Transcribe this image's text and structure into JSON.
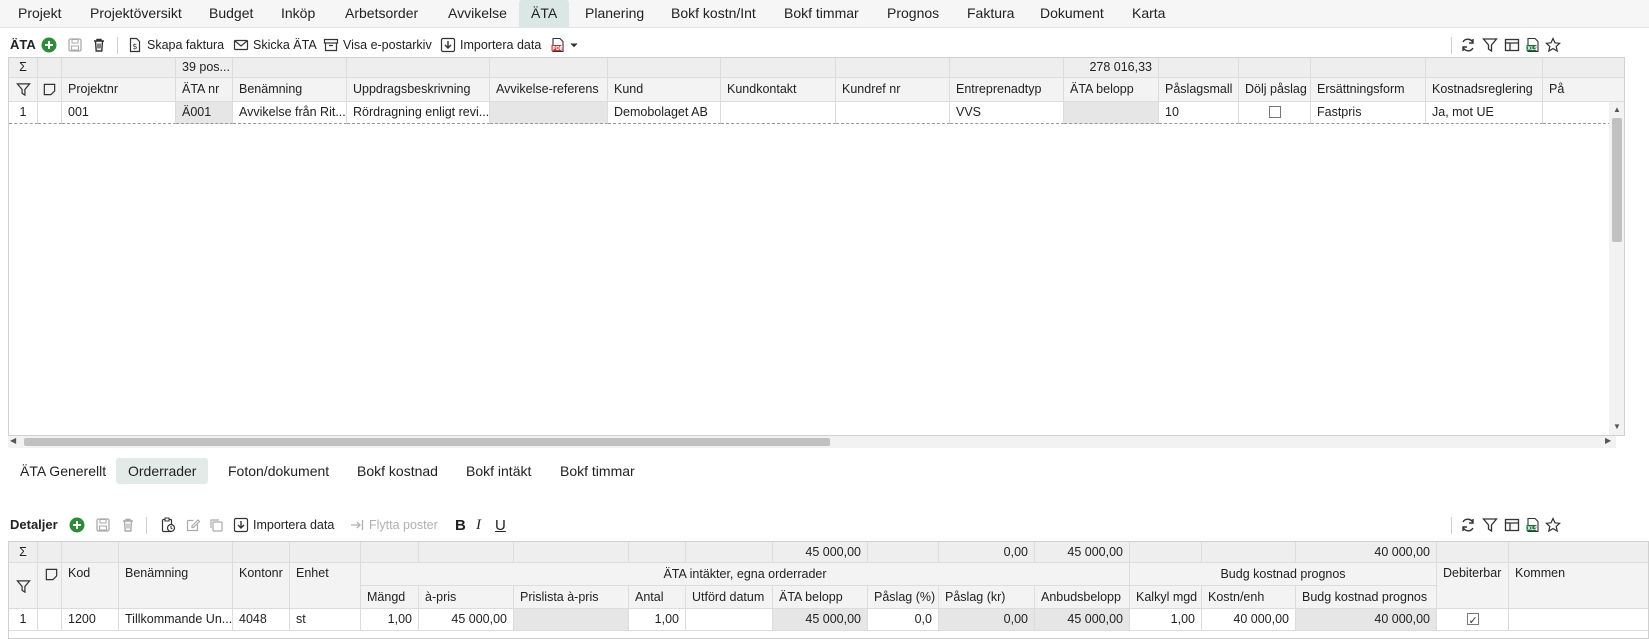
{
  "nav": {
    "tabs": [
      "Projekt",
      "Projektöversikt",
      "Budget",
      "Inköp",
      "Arbetsorder",
      "Avvikelse",
      "ÄTA",
      "Planering",
      "Bokf kostn/Int",
      "Bokf timmar",
      "Prognos",
      "Faktura",
      "Dokument",
      "Karta"
    ],
    "active": "ÄTA"
  },
  "ata_toolbar": {
    "title": "ÄTA",
    "skapa_faktura": "Skapa faktura",
    "skicka_ata": "Skicka ÄTA",
    "visa_epostarkiv": "Visa e-postarkiv",
    "importera_data": "Importera data"
  },
  "ata_grid": {
    "summary": {
      "ata_nr": "39 pos...",
      "ata_belopp": "278 016,33"
    },
    "columns": [
      "Projektnr",
      "ÄTA nr",
      "Benämning",
      "Uppdragsbeskrivning",
      "Avvikelse-referens",
      "Kund",
      "Kundkontakt",
      "Kundref nr",
      "Entreprenadtyp",
      "ÄTA belopp",
      "Påslagsmall",
      "Dölj påslag",
      "Ersättningsform",
      "Kostnadsreglering",
      "På"
    ],
    "rows": [
      {
        "rownum": "1",
        "projektnr": "001",
        "ata_nr": "Ä001",
        "benamning": "Avvikelse från Rit...",
        "uppdrag": "Rördragning enligt revi...",
        "avvikelse_ref": "",
        "kund": "Demobolaget AB",
        "kundkontakt": "",
        "kundref": "",
        "entreprenadtyp": "VVS",
        "ata_belopp": "",
        "paslagsmall": "10",
        "dolj_paslag": false,
        "ersattningsform": "Fastpris",
        "kostnadsreglering": "Ja, mot UE"
      }
    ]
  },
  "subtabs": {
    "tabs": [
      "ÄTA Generellt",
      "Orderrader",
      "Foton/dokument",
      "Bokf kostnad",
      "Bokf intäkt",
      "Bokf timmar"
    ],
    "active": "Orderrader"
  },
  "detail_toolbar": {
    "title": "Detaljer",
    "importera_data": "Importera data",
    "flytta_poster": "Flytta poster"
  },
  "detail_grid": {
    "summary": {
      "ata_belopp": "45 000,00",
      "paslag_kr": "0,00",
      "anbudsbelopp": "45 000,00",
      "budg_kostnad": "40 000,00"
    },
    "group_headers": {
      "intakter": "ÄTA intäkter, egna orderrader",
      "budg": "Budg kostnad prognos"
    },
    "columns": {
      "kod": "Kod",
      "benamning": "Benämning",
      "kontonr": "Kontonr",
      "enhet": "Enhet",
      "mangd": "Mängd",
      "apris": "à-pris",
      "prislista": "Prislista à-pris",
      "antal": "Antal",
      "utford": "Utförd datum",
      "ata_belopp": "ÄTA belopp",
      "paslag_pct": "Påslag (%)",
      "paslag_kr": "Påslag (kr)",
      "anbudsbelopp": "Anbudsbelopp",
      "kalkyl_mgd": "Kalkyl mgd",
      "kostn_enh": "Kostn/enh",
      "budg_kostnad": "Budg kostnad prognos",
      "debiterbar": "Debiterbar",
      "kommentar": "Kommen"
    },
    "rows": [
      {
        "rownum": "1",
        "kod": "1200",
        "benamning": "Tillkommande Un...",
        "kontonr": "4048",
        "enhet": "st",
        "mangd": "1,00",
        "apris": "45 000,00",
        "prislista": "",
        "antal": "1,00",
        "utford": "",
        "ata_belopp": "45 000,00",
        "paslag_pct": "0,0",
        "paslag_kr": "0,00",
        "anbudsbelopp": "45 000,00",
        "kalkyl_mgd": "1,00",
        "kostn_enh": "40 000,00",
        "budg_kostnad": "40 000,00",
        "debiterbar": true
      }
    ]
  },
  "colors": {
    "accent_green": "#2e8b3a",
    "active_tab": "#dbe7e4",
    "pdf_red": "#d9312b"
  }
}
